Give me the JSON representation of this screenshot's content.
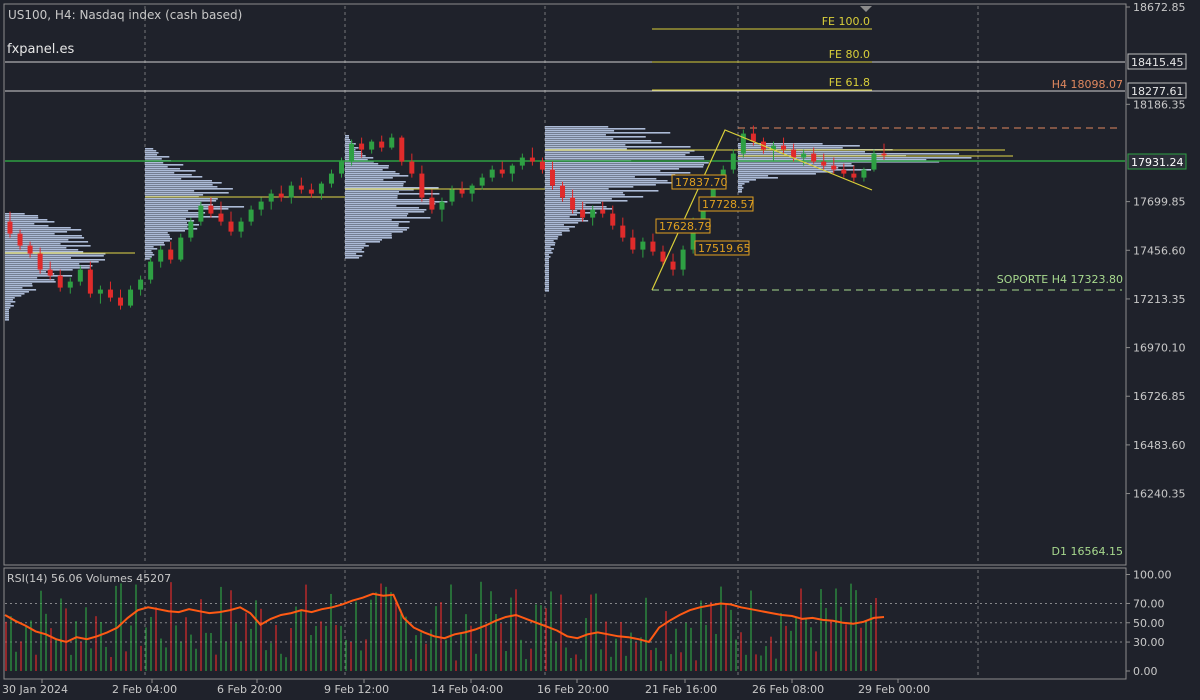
{
  "header": {
    "symbol_info": "US100, H4:  Nasdaq index (cash based)",
    "watermark": "fxpanel.es"
  },
  "colors": {
    "background": "#1f222b",
    "grid": "#8c8c8c",
    "axis_text": "#c8c8c8",
    "bull": "#2ea043",
    "bear": "#e02b2b",
    "profile": "#b8c9e6",
    "fib": "#d9cf3a",
    "rsi": "#ff5a14",
    "support": "#a7d98e",
    "resistance": "#e0885f"
  },
  "price_axis": {
    "labels": [
      "18672.85",
      "18186.35",
      "17699.85",
      "17456.60",
      "17213.35",
      "16970.10",
      "16726.85",
      "16483.60",
      "16240.35"
    ],
    "ylim": [
      16100,
      18672.85
    ]
  },
  "time_axis": {
    "labels": [
      "30 Jan 2024",
      "2 Feb 04:00",
      "6 Feb 20:00",
      "9 Feb 12:00",
      "14 Feb 04:00",
      "16 Feb 20:00",
      "21 Feb 16:00",
      "26 Feb 08:00",
      "29 Feb 00:00"
    ]
  },
  "price_tags": {
    "upper": "18415.45",
    "mid": "18277.61",
    "current": "17931.24"
  },
  "levels": {
    "fe100": {
      "label": "FE 100.0",
      "price": 18595
    },
    "fe80": {
      "label": "FE 80.0",
      "price": 18440
    },
    "fe618": {
      "label": "FE 61.8",
      "price": 18300
    },
    "h4_resistance": {
      "label": "H4 18098.07",
      "price": 18098.07
    },
    "support": {
      "label": "SOPORTE H4 17323.80",
      "price": 17323.8
    },
    "d1": {
      "label": "D1 16564.15",
      "price": 16564.15
    }
  },
  "fib_boxes": [
    "17837.70",
    "17728.57",
    "17628.79",
    "17519.65"
  ],
  "rsi_panel": {
    "header": "RSI(14) 56.06 Volumes 45207",
    "labels": [
      "100.00",
      "70.00",
      "50.00",
      "30.00",
      "0.00"
    ]
  },
  "chart_data": {
    "type": "candlestick",
    "instrument": "US100",
    "timeframe": "H4",
    "ohlc_approx": [
      [
        17600,
        17650,
        17520,
        17540
      ],
      [
        17540,
        17560,
        17460,
        17480
      ],
      [
        17480,
        17500,
        17420,
        17440
      ],
      [
        17440,
        17470,
        17340,
        17360
      ],
      [
        17360,
        17400,
        17310,
        17330
      ],
      [
        17330,
        17360,
        17250,
        17270
      ],
      [
        17270,
        17320,
        17240,
        17300
      ],
      [
        17300,
        17380,
        17280,
        17360
      ],
      [
        17360,
        17400,
        17220,
        17240
      ],
      [
        17240,
        17280,
        17190,
        17260
      ],
      [
        17260,
        17300,
        17200,
        17220
      ],
      [
        17220,
        17260,
        17160,
        17180
      ],
      [
        17180,
        17280,
        17170,
        17260
      ],
      [
        17260,
        17330,
        17230,
        17310
      ],
      [
        17310,
        17420,
        17290,
        17400
      ],
      [
        17400,
        17480,
        17370,
        17460
      ],
      [
        17460,
        17500,
        17390,
        17410
      ],
      [
        17410,
        17540,
        17400,
        17520
      ],
      [
        17520,
        17620,
        17500,
        17600
      ],
      [
        17600,
        17700,
        17580,
        17680
      ],
      [
        17680,
        17720,
        17620,
        17640
      ],
      [
        17640,
        17700,
        17580,
        17600
      ],
      [
        17600,
        17650,
        17530,
        17550
      ],
      [
        17550,
        17620,
        17520,
        17600
      ],
      [
        17600,
        17680,
        17580,
        17660
      ],
      [
        17660,
        17720,
        17630,
        17700
      ],
      [
        17700,
        17760,
        17660,
        17740
      ],
      [
        17740,
        17780,
        17700,
        17720
      ],
      [
        17720,
        17800,
        17690,
        17780
      ],
      [
        17780,
        17820,
        17740,
        17760
      ],
      [
        17760,
        17790,
        17720,
        17740
      ],
      [
        17740,
        17800,
        17710,
        17790
      ],
      [
        17790,
        17860,
        17770,
        17840
      ],
      [
        17840,
        17920,
        17820,
        17900
      ],
      [
        17900,
        18010,
        17880,
        17990
      ],
      [
        17990,
        18020,
        17920,
        17960
      ],
      [
        17960,
        18010,
        17940,
        18000
      ],
      [
        18000,
        18030,
        17950,
        17970
      ],
      [
        17970,
        18040,
        17960,
        18020
      ],
      [
        18020,
        18030,
        17880,
        17900
      ],
      [
        17900,
        17940,
        17820,
        17840
      ],
      [
        17840,
        17880,
        17700,
        17720
      ],
      [
        17720,
        17760,
        17640,
        17660
      ],
      [
        17660,
        17720,
        17600,
        17700
      ],
      [
        17700,
        17780,
        17680,
        17760
      ],
      [
        17760,
        17800,
        17720,
        17740
      ],
      [
        17740,
        17790,
        17700,
        17780
      ],
      [
        17780,
        17840,
        17760,
        17820
      ],
      [
        17820,
        17880,
        17800,
        17860
      ],
      [
        17860,
        17900,
        17820,
        17840
      ],
      [
        17840,
        17890,
        17800,
        17880
      ],
      [
        17880,
        17940,
        17860,
        17920
      ],
      [
        17920,
        17970,
        17880,
        17900
      ],
      [
        17900,
        17920,
        17840,
        17860
      ],
      [
        17860,
        17900,
        17760,
        17780
      ],
      [
        17780,
        17800,
        17700,
        17720
      ],
      [
        17720,
        17760,
        17640,
        17660
      ],
      [
        17660,
        17700,
        17600,
        17620
      ],
      [
        17620,
        17680,
        17580,
        17660
      ],
      [
        17660,
        17700,
        17620,
        17640
      ],
      [
        17640,
        17680,
        17560,
        17580
      ],
      [
        17580,
        17620,
        17500,
        17520
      ],
      [
        17520,
        17560,
        17440,
        17460
      ],
      [
        17460,
        17520,
        17420,
        17500
      ],
      [
        17500,
        17540,
        17430,
        17450
      ],
      [
        17450,
        17480,
        17380,
        17400
      ],
      [
        17400,
        17440,
        17330,
        17360
      ],
      [
        17360,
        17480,
        17330,
        17460
      ],
      [
        17460,
        17620,
        17440,
        17600
      ],
      [
        17600,
        17720,
        17580,
        17700
      ],
      [
        17700,
        17800,
        17680,
        17780
      ],
      [
        17780,
        17880,
        17760,
        17860
      ],
      [
        17860,
        17960,
        17840,
        17940
      ],
      [
        17940,
        18060,
        17920,
        18040
      ],
      [
        18040,
        18080,
        17980,
        18000
      ],
      [
        18000,
        18020,
        17940,
        17960
      ],
      [
        17960,
        18000,
        17900,
        17980
      ],
      [
        17980,
        18020,
        17940,
        17960
      ],
      [
        17960,
        17990,
        17900,
        17920
      ],
      [
        17920,
        17960,
        17880,
        17940
      ],
      [
        17940,
        17970,
        17890,
        17900
      ],
      [
        17900,
        17940,
        17860,
        17880
      ],
      [
        17880,
        17920,
        17840,
        17860
      ],
      [
        17860,
        17890,
        17820,
        17840
      ],
      [
        17840,
        17880,
        17800,
        17820
      ],
      [
        17820,
        17870,
        17800,
        17860
      ],
      [
        17860,
        17960,
        17850,
        17940
      ],
      [
        17940,
        17990,
        17910,
        17931
      ]
    ],
    "rsi_approx": [
      58,
      52,
      47,
      41,
      38,
      33,
      30,
      35,
      33,
      36,
      40,
      45,
      55,
      63,
      66,
      64,
      62,
      61,
      64,
      62,
      60,
      61,
      63,
      66,
      60,
      48,
      54,
      58,
      60,
      63,
      61,
      64,
      66,
      69,
      73,
      76,
      80,
      78,
      79,
      55,
      45,
      40,
      36,
      34,
      38,
      40,
      43,
      47,
      52,
      56,
      58,
      54,
      50,
      46,
      42,
      36,
      34,
      38,
      40,
      38,
      36,
      35,
      33,
      30,
      45,
      52,
      58,
      63,
      66,
      68,
      70,
      69,
      66,
      64,
      62,
      60,
      58,
      57,
      54,
      55,
      53,
      52,
      50,
      49,
      51,
      55,
      56
    ],
    "rsi_levels": [
      70,
      50,
      30
    ]
  }
}
